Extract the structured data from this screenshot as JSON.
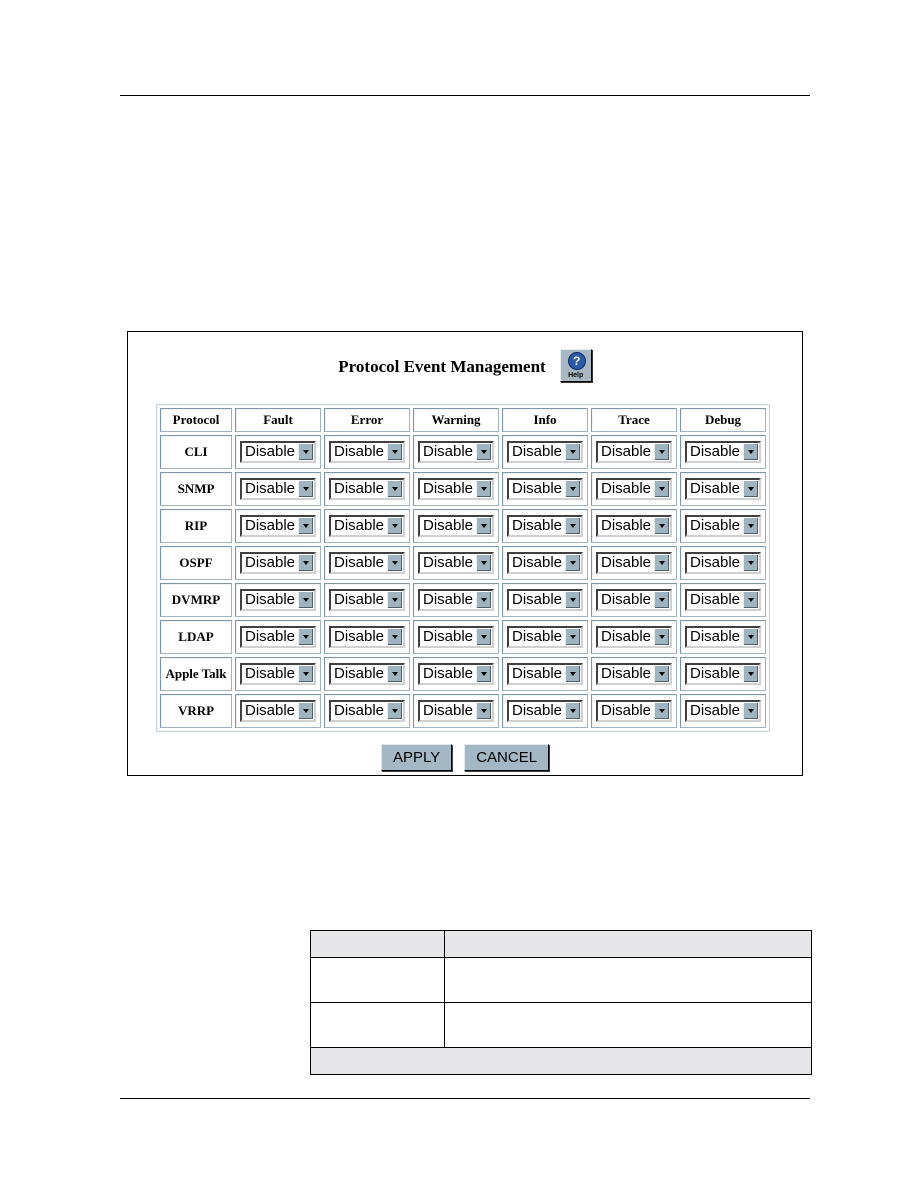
{
  "screen": {
    "title": "Protocol Event Management",
    "help_button": {
      "label": "Help",
      "icon": "question-mark-icon"
    },
    "table": {
      "columns": [
        "Protocol",
        "Fault",
        "Error",
        "Warning",
        "Info",
        "Trace",
        "Debug"
      ],
      "rows": [
        {
          "protocol": "CLI",
          "values": [
            "Disable",
            "Disable",
            "Disable",
            "Disable",
            "Disable",
            "Disable"
          ]
        },
        {
          "protocol": "SNMP",
          "values": [
            "Disable",
            "Disable",
            "Disable",
            "Disable",
            "Disable",
            "Disable"
          ]
        },
        {
          "protocol": "RIP",
          "values": [
            "Disable",
            "Disable",
            "Disable",
            "Disable",
            "Disable",
            "Disable"
          ]
        },
        {
          "protocol": "OSPF",
          "values": [
            "Disable",
            "Disable",
            "Disable",
            "Disable",
            "Disable",
            "Disable"
          ]
        },
        {
          "protocol": "DVMRP",
          "values": [
            "Disable",
            "Disable",
            "Disable",
            "Disable",
            "Disable",
            "Disable"
          ]
        },
        {
          "protocol": "LDAP",
          "values": [
            "Disable",
            "Disable",
            "Disable",
            "Disable",
            "Disable",
            "Disable"
          ]
        },
        {
          "protocol": "Apple Talk",
          "values": [
            "Disable",
            "Disable",
            "Disable",
            "Disable",
            "Disable",
            "Disable"
          ]
        },
        {
          "protocol": "VRRP",
          "values": [
            "Disable",
            "Disable",
            "Disable",
            "Disable",
            "Disable",
            "Disable"
          ]
        }
      ]
    },
    "buttons": {
      "apply": "APPLY",
      "cancel": "CANCEL"
    }
  },
  "param_table": {
    "header": [
      "",
      ""
    ],
    "rows": [
      [
        "",
        ""
      ],
      [
        "",
        ""
      ]
    ],
    "footer": ""
  }
}
